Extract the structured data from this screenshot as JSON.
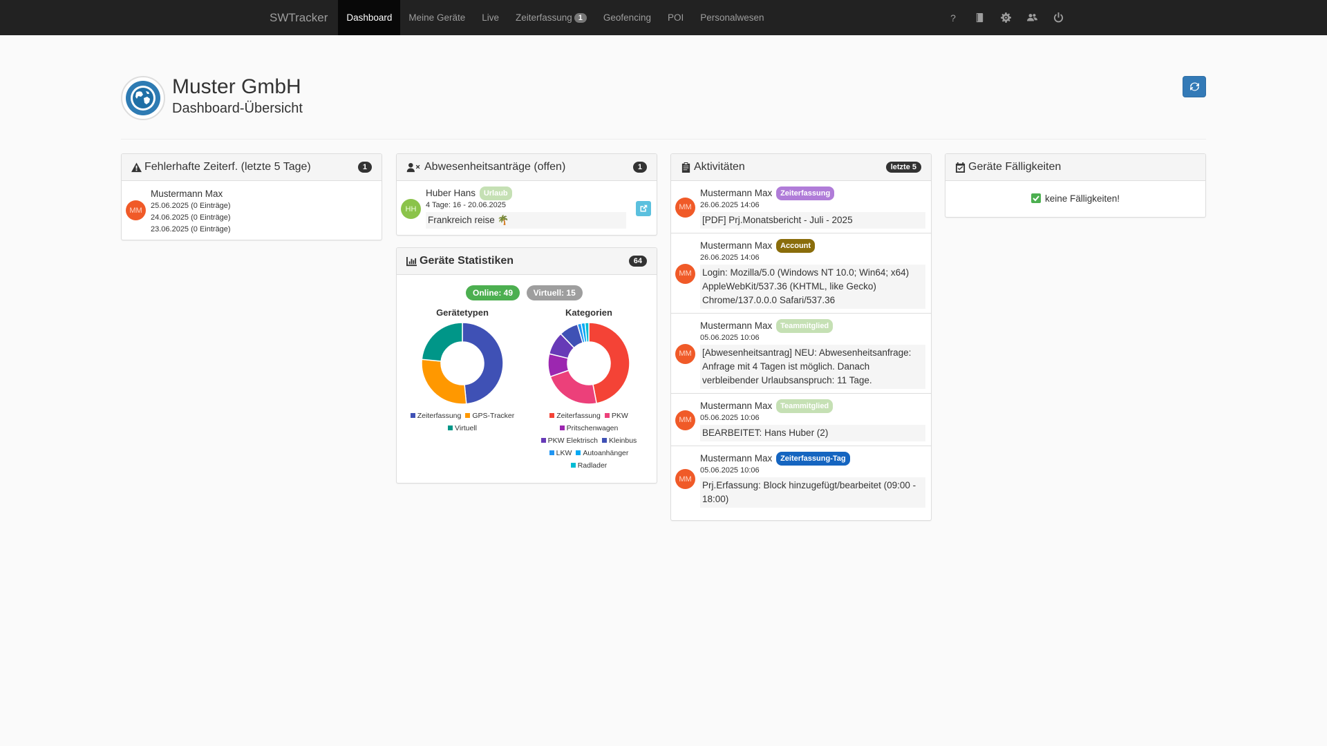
{
  "nav": {
    "brand": "SWTracker",
    "items": [
      {
        "label": "Dashboard",
        "active": true
      },
      {
        "label": "Meine Geräte"
      },
      {
        "label": "Live"
      },
      {
        "label": "Zeiterfassung",
        "badge": "1"
      },
      {
        "label": "Geofencing"
      },
      {
        "label": "POI"
      },
      {
        "label": "Personalwesen"
      }
    ],
    "right_icons": [
      "help-icon",
      "book-icon",
      "gear-icon",
      "users-icon",
      "power-icon"
    ],
    "help_glyph": "?"
  },
  "header": {
    "company": "Muster GmbH",
    "subtitle": "Dashboard-Übersicht"
  },
  "panels": {
    "fehler": {
      "title": "Fehlerhafte Zeiterf. (letzte 5 Tage)",
      "badge": "1",
      "entries": [
        {
          "initials": "MM",
          "name": "Mustermann Max",
          "lines": [
            "25.06.2025 (0 Einträge)",
            "24.06.2025 (0 Einträge)",
            "23.06.2025 (0 Einträge)"
          ]
        }
      ]
    },
    "abwesenheit": {
      "title": "Abwesenheitsanträge (offen)",
      "badge": "1",
      "entry": {
        "initials": "HH",
        "name": "Huber Hans",
        "label": "Urlaub",
        "date": "4 Tage: 16 - 20.06.2025",
        "msg": "Frankreich reise 🌴"
      }
    },
    "statistik": {
      "title": "Geräte Statistiken",
      "badge": "64",
      "online": "Online: 49",
      "virtuell": "Virtuell: 15"
    },
    "aktivitaeten": {
      "title": "Aktivitäten",
      "badge": "letzte 5",
      "entries": [
        {
          "initials": "MM",
          "name": "Mustermann Max",
          "label": "Zeiterfassung",
          "color": "#b07cd8",
          "date": "26.06.2025 14:06",
          "msg": "[PDF] Prj.Monatsbericht - Juli - 2025"
        },
        {
          "initials": "MM",
          "name": "Mustermann Max",
          "label": "Account",
          "color": "#8a6d0b",
          "date": "26.06.2025 14:06",
          "msg": "Login: Mozilla/5.0 (Windows NT 10.0; Win64; x64) AppleWebKit/537.36 (KHTML, like Gecko) Chrome/137.0.0.0 Safari/537.36"
        },
        {
          "initials": "MM",
          "name": "Mustermann Max",
          "label": "Teammitglied",
          "color": "#c5e0b4",
          "date": "05.06.2025 10:06",
          "msg": "[Abwesenheitsantrag] NEU: Abwesenheitsanfrage: Anfrage mit 4 Tagen ist möglich. Danach verbleibender Urlaubsanspruch: 11 Tage."
        },
        {
          "initials": "MM",
          "name": "Mustermann Max",
          "label": "Teammitglied",
          "color": "#c5e0b4",
          "date": "05.06.2025 10:06",
          "msg": "BEARBEITET: Hans Huber (2)"
        },
        {
          "initials": "MM",
          "name": "Mustermann Max",
          "label": "Zeiterfassung-Tag",
          "color": "#1565c0",
          "date": "05.06.2025 10:06",
          "msg": "Prj.Erfassung: Block hinzugefügt/bearbeitet (09:00 - 18:00)"
        }
      ]
    },
    "faelligkeiten": {
      "title": "Geräte Fälligkeiten",
      "msg": "keine Fälligkeiten!"
    }
  },
  "chart_data": [
    {
      "type": "pie",
      "title": "Gerätetypen",
      "categories": [
        "Zeiterfassung",
        "GPS-Tracker",
        "Virtuell"
      ],
      "values": [
        31,
        18,
        15
      ],
      "colors": [
        "#3f51b5",
        "#ff9800",
        "#009688"
      ]
    },
    {
      "type": "pie",
      "title": "Kategorien",
      "categories": [
        "Zeiterfassung",
        "PKW",
        "Pritschenwagen",
        "PKW Elektrisch",
        "Kleinbus",
        "LKW",
        "Autoanhänger",
        "Radlader"
      ],
      "values": [
        31,
        15,
        6,
        6,
        5,
        1,
        1,
        1
      ],
      "colors": [
        "#f44336",
        "#ec407a",
        "#9c27b0",
        "#673ab7",
        "#3f51b5",
        "#2196f3",
        "#03a9f4",
        "#00bcd4"
      ]
    }
  ]
}
